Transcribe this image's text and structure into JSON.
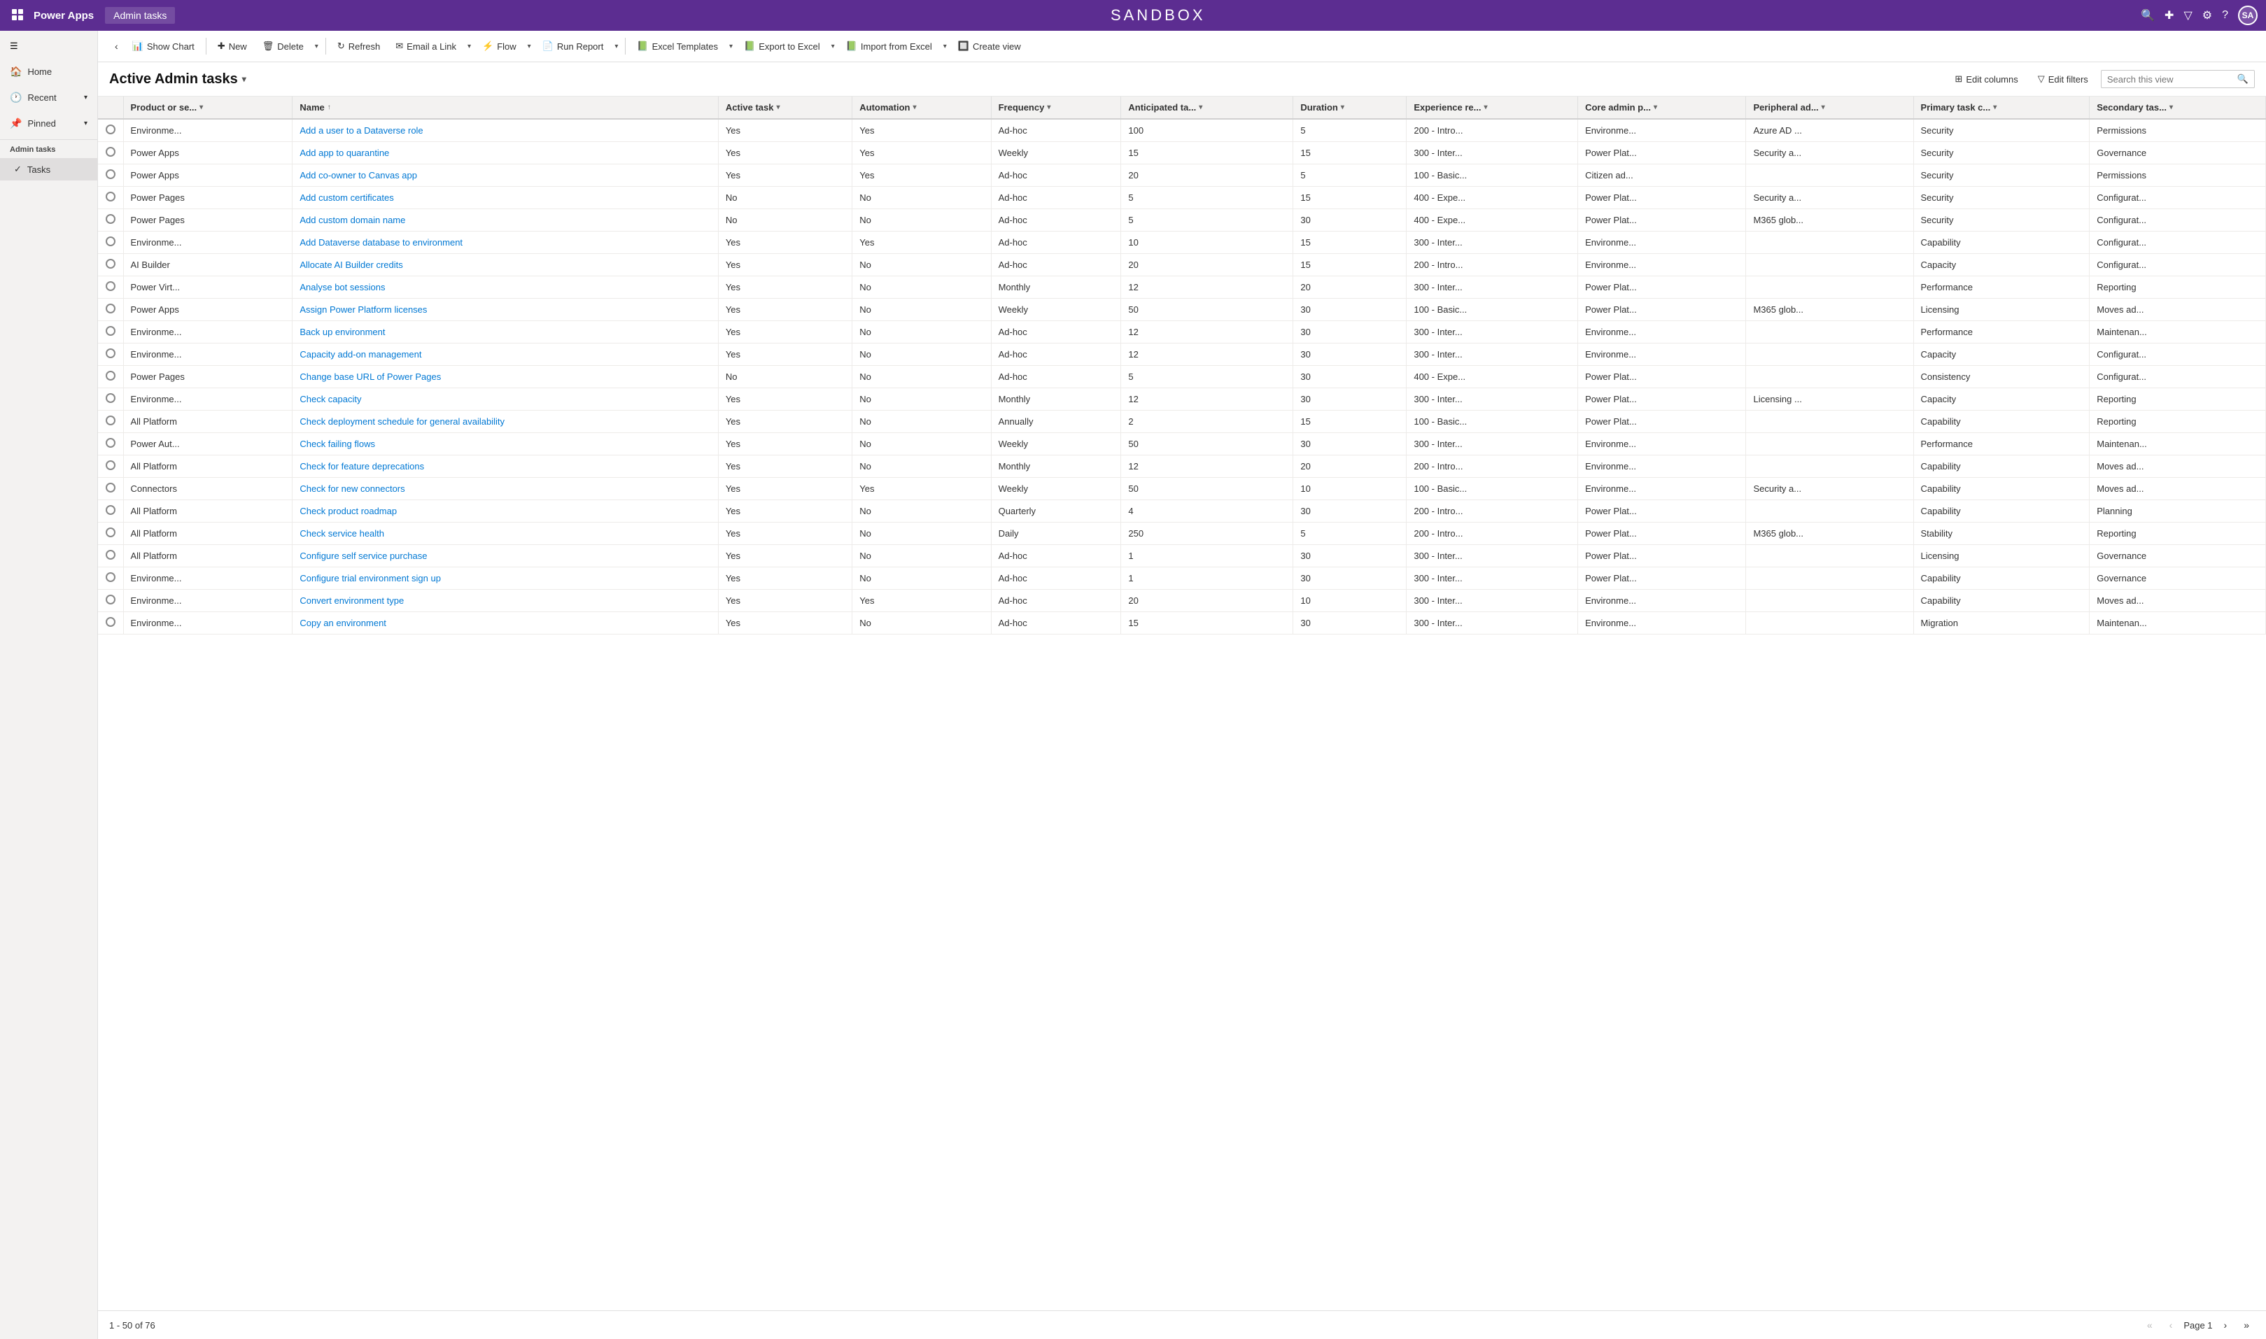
{
  "topNav": {
    "appIcon": "⊞",
    "appTitle": "Power Apps",
    "contextTitle": "Admin tasks",
    "sandboxTitle": "SANDBOX",
    "icons": [
      "🔍",
      "✚",
      "▽",
      "⚙",
      "?"
    ],
    "avatar": "SA"
  },
  "sidebar": {
    "hamburger": "☰",
    "items": [
      {
        "id": "home",
        "label": "Home",
        "icon": "🏠"
      },
      {
        "id": "recent",
        "label": "Recent",
        "icon": "🕐",
        "caret": "▾"
      },
      {
        "id": "pinned",
        "label": "Pinned",
        "icon": "📌",
        "caret": "▾"
      }
    ],
    "section": "Admin tasks",
    "sectionItems": [
      {
        "id": "tasks",
        "label": "Tasks",
        "icon": "✓",
        "active": true
      }
    ]
  },
  "toolbar": {
    "backLabel": "‹",
    "showChartLabel": "Show Chart",
    "newLabel": "New",
    "deleteLabel": "Delete",
    "refreshLabel": "Refresh",
    "emailLinkLabel": "Email a Link",
    "flowLabel": "Flow",
    "runReportLabel": "Run Report",
    "excelTemplatesLabel": "Excel Templates",
    "exportToExcelLabel": "Export to Excel",
    "importFromExcelLabel": "Import from Excel",
    "createViewLabel": "Create view",
    "icons": {
      "back": "‹",
      "chart": "📊",
      "new": "✚",
      "delete": "🗑",
      "refresh": "↻",
      "email": "✉",
      "flow": "⚡",
      "report": "📄",
      "excel": "📗",
      "exportExcel": "📗",
      "importExcel": "📗",
      "createView": "🔲"
    }
  },
  "viewHeader": {
    "title": "Active Admin tasks",
    "editColumnsLabel": "Edit columns",
    "editFiltersLabel": "Edit filters",
    "searchPlaceholder": "Search this view",
    "searchIcon": "🔍",
    "editColumnsIcon": "⊞",
    "editFiltersIcon": "▽"
  },
  "table": {
    "columns": [
      {
        "id": "product",
        "label": "Product or se...",
        "sortable": true
      },
      {
        "id": "name",
        "label": "Name",
        "sortable": true,
        "sorted": "asc"
      },
      {
        "id": "activeTask",
        "label": "Active task",
        "sortable": true
      },
      {
        "id": "automation",
        "label": "Automation",
        "sortable": true
      },
      {
        "id": "frequency",
        "label": "Frequency",
        "sortable": true
      },
      {
        "id": "anticipatedTa",
        "label": "Anticipated ta...",
        "sortable": true
      },
      {
        "id": "duration",
        "label": "Duration",
        "sortable": true
      },
      {
        "id": "experienceRe",
        "label": "Experience re...",
        "sortable": true
      },
      {
        "id": "coreAdminP",
        "label": "Core admin p...",
        "sortable": true
      },
      {
        "id": "peripheralAd",
        "label": "Peripheral ad...",
        "sortable": true
      },
      {
        "id": "primaryTaskC",
        "label": "Primary task c...",
        "sortable": true
      },
      {
        "id": "secondaryTas",
        "label": "Secondary tas...",
        "sortable": true
      }
    ],
    "rows": [
      {
        "product": "Environme...",
        "name": "Add a user to a Dataverse role",
        "activeTask": "Yes",
        "automation": "Yes",
        "frequency": "Ad-hoc",
        "anticipatedTa": "100",
        "duration": "5",
        "experienceRe": "200 - Intro...",
        "coreAdminP": "Environme...",
        "peripheralAd": "Azure AD ...",
        "primaryTaskC": "Security",
        "secondaryTas": "Permissions"
      },
      {
        "product": "Power Apps",
        "name": "Add app to quarantine",
        "activeTask": "Yes",
        "automation": "Yes",
        "frequency": "Weekly",
        "anticipatedTa": "15",
        "duration": "15",
        "experienceRe": "300 - Inter...",
        "coreAdminP": "Power Plat...",
        "peripheralAd": "Security a...",
        "primaryTaskC": "Security",
        "secondaryTas": "Governance"
      },
      {
        "product": "Power Apps",
        "name": "Add co-owner to Canvas app",
        "activeTask": "Yes",
        "automation": "Yes",
        "frequency": "Ad-hoc",
        "anticipatedTa": "20",
        "duration": "5",
        "experienceRe": "100 - Basic...",
        "coreAdminP": "Citizen ad...",
        "peripheralAd": "",
        "primaryTaskC": "Security",
        "secondaryTas": "Permissions"
      },
      {
        "product": "Power Pages",
        "name": "Add custom certificates",
        "activeTask": "No",
        "automation": "No",
        "frequency": "Ad-hoc",
        "anticipatedTa": "5",
        "duration": "15",
        "experienceRe": "400 - Expe...",
        "coreAdminP": "Power Plat...",
        "peripheralAd": "Security a...",
        "primaryTaskC": "Security",
        "secondaryTas": "Configurat..."
      },
      {
        "product": "Power Pages",
        "name": "Add custom domain name",
        "activeTask": "No",
        "automation": "No",
        "frequency": "Ad-hoc",
        "anticipatedTa": "5",
        "duration": "30",
        "experienceRe": "400 - Expe...",
        "coreAdminP": "Power Plat...",
        "peripheralAd": "M365 glob...",
        "primaryTaskC": "Security",
        "secondaryTas": "Configurat..."
      },
      {
        "product": "Environme...",
        "name": "Add Dataverse database to environment",
        "activeTask": "Yes",
        "automation": "Yes",
        "frequency": "Ad-hoc",
        "anticipatedTa": "10",
        "duration": "15",
        "experienceRe": "300 - Inter...",
        "coreAdminP": "Environme...",
        "peripheralAd": "",
        "primaryTaskC": "Capability",
        "secondaryTas": "Configurat..."
      },
      {
        "product": "AI Builder",
        "name": "Allocate AI Builder credits",
        "activeTask": "Yes",
        "automation": "No",
        "frequency": "Ad-hoc",
        "anticipatedTa": "20",
        "duration": "15",
        "experienceRe": "200 - Intro...",
        "coreAdminP": "Environme...",
        "peripheralAd": "",
        "primaryTaskC": "Capacity",
        "secondaryTas": "Configurat..."
      },
      {
        "product": "Power Virt...",
        "name": "Analyse bot sessions",
        "activeTask": "Yes",
        "automation": "No",
        "frequency": "Monthly",
        "anticipatedTa": "12",
        "duration": "20",
        "experienceRe": "300 - Inter...",
        "coreAdminP": "Power Plat...",
        "peripheralAd": "",
        "primaryTaskC": "Performance",
        "secondaryTas": "Reporting"
      },
      {
        "product": "Power Apps",
        "name": "Assign Power Platform licenses",
        "activeTask": "Yes",
        "automation": "No",
        "frequency": "Weekly",
        "anticipatedTa": "50",
        "duration": "30",
        "experienceRe": "100 - Basic...",
        "coreAdminP": "Power Plat...",
        "peripheralAd": "M365 glob...",
        "primaryTaskC": "Licensing",
        "secondaryTas": "Moves ad..."
      },
      {
        "product": "Environme...",
        "name": "Back up environment",
        "activeTask": "Yes",
        "automation": "No",
        "frequency": "Ad-hoc",
        "anticipatedTa": "12",
        "duration": "30",
        "experienceRe": "300 - Inter...",
        "coreAdminP": "Environme...",
        "peripheralAd": "",
        "primaryTaskC": "Performance",
        "secondaryTas": "Maintenan..."
      },
      {
        "product": "Environme...",
        "name": "Capacity add-on management",
        "activeTask": "Yes",
        "automation": "No",
        "frequency": "Ad-hoc",
        "anticipatedTa": "12",
        "duration": "30",
        "experienceRe": "300 - Inter...",
        "coreAdminP": "Environme...",
        "peripheralAd": "",
        "primaryTaskC": "Capacity",
        "secondaryTas": "Configurat..."
      },
      {
        "product": "Power Pages",
        "name": "Change base URL of Power Pages",
        "activeTask": "No",
        "automation": "No",
        "frequency": "Ad-hoc",
        "anticipatedTa": "5",
        "duration": "30",
        "experienceRe": "400 - Expe...",
        "coreAdminP": "Power Plat...",
        "peripheralAd": "",
        "primaryTaskC": "Consistency",
        "secondaryTas": "Configurat..."
      },
      {
        "product": "Environme...",
        "name": "Check capacity",
        "activeTask": "Yes",
        "automation": "No",
        "frequency": "Monthly",
        "anticipatedTa": "12",
        "duration": "30",
        "experienceRe": "300 - Inter...",
        "coreAdminP": "Power Plat...",
        "peripheralAd": "Licensing ...",
        "primaryTaskC": "Capacity",
        "secondaryTas": "Reporting"
      },
      {
        "product": "All Platform",
        "name": "Check deployment schedule for general availability",
        "activeTask": "Yes",
        "automation": "No",
        "frequency": "Annually",
        "anticipatedTa": "2",
        "duration": "15",
        "experienceRe": "100 - Basic...",
        "coreAdminP": "Power Plat...",
        "peripheralAd": "",
        "primaryTaskC": "Capability",
        "secondaryTas": "Reporting"
      },
      {
        "product": "Power Aut...",
        "name": "Check failing flows",
        "activeTask": "Yes",
        "automation": "No",
        "frequency": "Weekly",
        "anticipatedTa": "50",
        "duration": "30",
        "experienceRe": "300 - Inter...",
        "coreAdminP": "Environme...",
        "peripheralAd": "",
        "primaryTaskC": "Performance",
        "secondaryTas": "Maintenan..."
      },
      {
        "product": "All Platform",
        "name": "Check for feature deprecations",
        "activeTask": "Yes",
        "automation": "No",
        "frequency": "Monthly",
        "anticipatedTa": "12",
        "duration": "20",
        "experienceRe": "200 - Intro...",
        "coreAdminP": "Environme...",
        "peripheralAd": "",
        "primaryTaskC": "Capability",
        "secondaryTas": "Moves ad..."
      },
      {
        "product": "Connectors",
        "name": "Check for new connectors",
        "activeTask": "Yes",
        "automation": "Yes",
        "frequency": "Weekly",
        "anticipatedTa": "50",
        "duration": "10",
        "experienceRe": "100 - Basic...",
        "coreAdminP": "Environme...",
        "peripheralAd": "Security a...",
        "primaryTaskC": "Capability",
        "secondaryTas": "Moves ad..."
      },
      {
        "product": "All Platform",
        "name": "Check product roadmap",
        "activeTask": "Yes",
        "automation": "No",
        "frequency": "Quarterly",
        "anticipatedTa": "4",
        "duration": "30",
        "experienceRe": "200 - Intro...",
        "coreAdminP": "Power Plat...",
        "peripheralAd": "",
        "primaryTaskC": "Capability",
        "secondaryTas": "Planning"
      },
      {
        "product": "All Platform",
        "name": "Check service health",
        "activeTask": "Yes",
        "automation": "No",
        "frequency": "Daily",
        "anticipatedTa": "250",
        "duration": "5",
        "experienceRe": "200 - Intro...",
        "coreAdminP": "Power Plat...",
        "peripheralAd": "M365 glob...",
        "primaryTaskC": "Stability",
        "secondaryTas": "Reporting"
      },
      {
        "product": "All Platform",
        "name": "Configure self service purchase",
        "activeTask": "Yes",
        "automation": "No",
        "frequency": "Ad-hoc",
        "anticipatedTa": "1",
        "duration": "30",
        "experienceRe": "300 - Inter...",
        "coreAdminP": "Power Plat...",
        "peripheralAd": "",
        "primaryTaskC": "Licensing",
        "secondaryTas": "Governance"
      },
      {
        "product": "Environme...",
        "name": "Configure trial environment sign up",
        "activeTask": "Yes",
        "automation": "No",
        "frequency": "Ad-hoc",
        "anticipatedTa": "1",
        "duration": "30",
        "experienceRe": "300 - Inter...",
        "coreAdminP": "Power Plat...",
        "peripheralAd": "",
        "primaryTaskC": "Capability",
        "secondaryTas": "Governance"
      },
      {
        "product": "Environme...",
        "name": "Convert environment type",
        "activeTask": "Yes",
        "automation": "Yes",
        "frequency": "Ad-hoc",
        "anticipatedTa": "20",
        "duration": "10",
        "experienceRe": "300 - Inter...",
        "coreAdminP": "Environme...",
        "peripheralAd": "",
        "primaryTaskC": "Capability",
        "secondaryTas": "Moves ad..."
      },
      {
        "product": "Environme...",
        "name": "Copy an environment",
        "activeTask": "Yes",
        "automation": "No",
        "frequency": "Ad-hoc",
        "anticipatedTa": "15",
        "duration": "30",
        "experienceRe": "300 - Inter...",
        "coreAdminP": "Environme...",
        "peripheralAd": "",
        "primaryTaskC": "Migration",
        "secondaryTas": "Maintenan..."
      }
    ]
  },
  "footer": {
    "recordCount": "1 - 50 of 76",
    "pageLabel": "Page 1",
    "firstIcon": "«",
    "prevIcon": "‹",
    "nextIcon": "›",
    "lastIcon": "»"
  }
}
